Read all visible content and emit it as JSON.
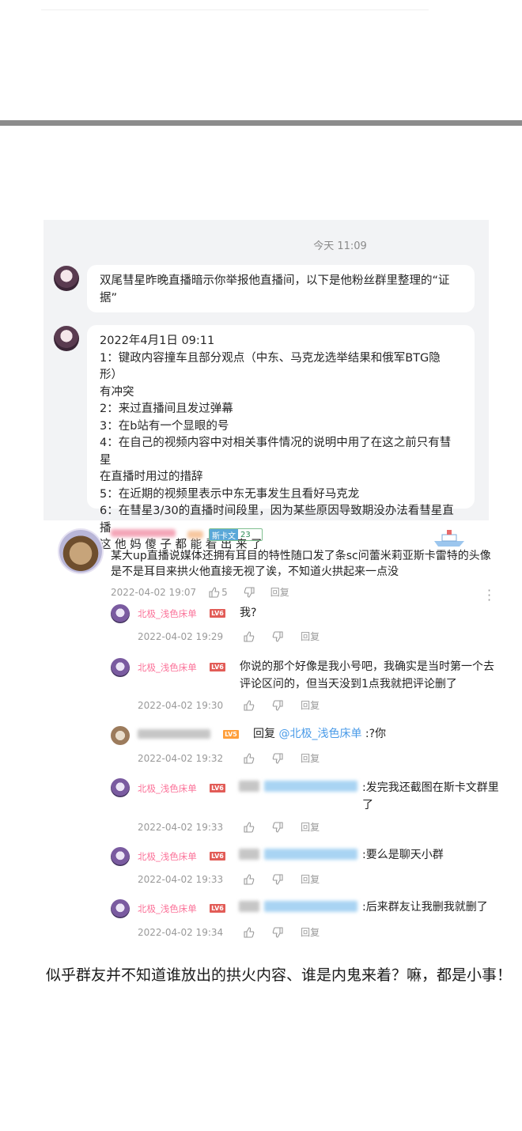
{
  "chat": {
    "time": "今天 11:09",
    "messages": [
      {
        "text": "双尾彗星昨晚直播暗示你举报他直播间，以下是他粉丝群里整理的“证\n据”"
      },
      {
        "text": "2022年4月1日 09:11\n1：键政内容撞车且部分观点（中东、马克龙选举结果和俄军BTG隐形）\n有冲突\n2：来过直播间且发过弹幕\n3：在b站有一个显眼的号\n4：在自己的视频内容中对相关事件情况的说明中用了在这之前只有彗星\n在直播时用过的措辞\n5：在近期的视频里表示中东无事发生且看好马克龙\n6：在彗星3/30的直播时间段里，因为某些原因导致期没办法看彗星直播\n这 他 妈 傻 子 都 能 看 出 来 了"
      }
    ]
  },
  "comment": {
    "badge_label": "斯卡文",
    "badge_level": "23",
    "text": "某大up直播说媒体还拥有耳目的特性随口发了条sc问蕾米莉亚斯卡雷特的头像是不是耳目来拱火他直接无视了诶，不知道火拱起来一点没",
    "date": "2022-04-02 19:07",
    "likes": "5",
    "reply_label": "回复"
  },
  "replies": [
    {
      "user": "北极_浅色床单",
      "level": "LV6",
      "text": "我?",
      "date": "2022-04-02 19:29",
      "reply_label": "回复"
    },
    {
      "user": "北极_浅色床单",
      "level": "LV6",
      "text": "你说的那个好像是我小号吧，我确实是当时第一个去\n评论区问的，但当天没到1点我就把评论删了",
      "date": "2022-04-02 19:30",
      "reply_label": "回复"
    },
    {
      "user": "",
      "level": "LV5",
      "prefix": "回复 ",
      "at": "@北极_浅色床单",
      "text": " :?你",
      "date": "2022-04-02 19:32",
      "reply_label": "回复"
    },
    {
      "user": "北极_浅色床单",
      "level": "LV6",
      "text": ":发完我还截图在斯卡文群里\n了",
      "date": "2022-04-02 19:33",
      "reply_label": "回复"
    },
    {
      "user": "北极_浅色床单",
      "level": "LV6",
      "text": ":要么是聊天小群",
      "date": "2022-04-02 19:33",
      "reply_label": "回复"
    },
    {
      "user": "北极_浅色床单",
      "level": "LV6",
      "text": ":后来群友让我删我就删了",
      "date": "2022-04-02 19:34",
      "reply_label": "回复"
    }
  ],
  "article": {
    "paragraph": "似乎群友并不知道谁放出的拱火内容、谁是内鬼来着？嘛，都是小事！"
  },
  "colors": {
    "pink_name": "#fb7299",
    "link_blue": "#4a9be8",
    "level_red": "#e25c57"
  }
}
